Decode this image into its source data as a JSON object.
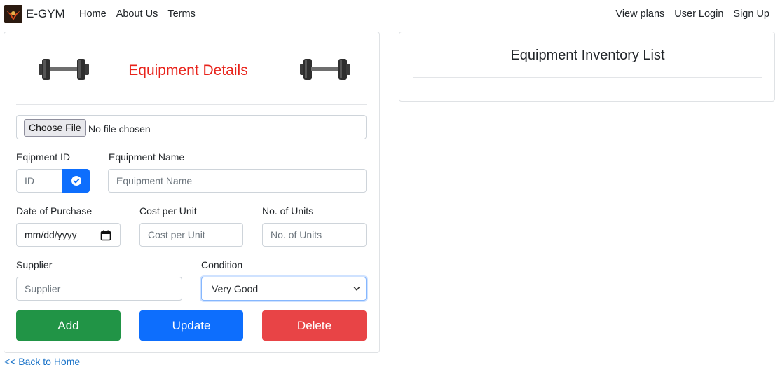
{
  "navbar": {
    "brand": "E-GYM",
    "left_links": [
      "Home",
      "About Us",
      "Terms"
    ],
    "right_links": [
      "View plans",
      "User Login",
      "Sign Up"
    ]
  },
  "form": {
    "title": "Equipment Details",
    "file": {
      "button": "Choose File",
      "status": "No file chosen"
    },
    "id": {
      "label": "Eqipment ID",
      "placeholder": "ID"
    },
    "name": {
      "label": "Equipment Name",
      "placeholder": "Equipment Name"
    },
    "date": {
      "label": "Date of Purchase",
      "placeholder": "mm/dd/yyyy"
    },
    "cost": {
      "label": "Cost per Unit",
      "placeholder": "Cost per Unit"
    },
    "units": {
      "label": "No. of Units",
      "placeholder": "No. of Units"
    },
    "supplier": {
      "label": "Supplier",
      "placeholder": "Supplier"
    },
    "condition": {
      "label": "Condition",
      "selected": "Very Good"
    },
    "buttons": {
      "add": "Add",
      "update": "Update",
      "delete": "Delete"
    }
  },
  "back_link": "<< Back to Home",
  "inventory": {
    "title": "Equipment Inventory List"
  },
  "colors": {
    "title_red": "#e8231b",
    "add_green": "#219446",
    "update_blue": "#0d6efd",
    "delete_red": "#e84446",
    "link_blue": "#1a73c8"
  },
  "icons": [
    "gym-logo-icon",
    "dumbbell-icon",
    "check-circle-icon",
    "calendar-icon",
    "chevron-down-icon"
  ]
}
